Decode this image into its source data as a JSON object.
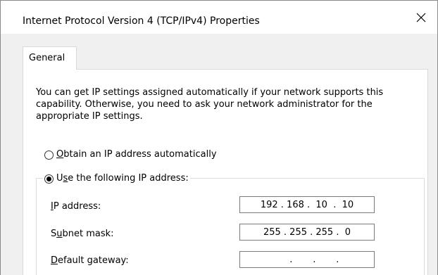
{
  "window": {
    "title": "Internet Protocol Version 4 (TCP/IPv4) Properties",
    "close_icon": "close-icon"
  },
  "tabs": [
    {
      "label": "General",
      "selected": true
    }
  ],
  "description": "You can get IP settings assigned automatically if your network supports this capability. Otherwise, you need to ask your network administrator for the appropriate IP settings.",
  "ip_mode": {
    "auto": {
      "label_pre": "",
      "label_u": "O",
      "label_post": "btain an IP address automatically",
      "checked": false
    },
    "manual": {
      "label_pre": "U",
      "label_u": "s",
      "label_post": "e the following IP address:",
      "checked": true
    }
  },
  "fields": {
    "ip_address": {
      "label_u": "I",
      "label_post": "P address:",
      "value": "192 . 168 .  10  .  10"
    },
    "subnet_mask": {
      "label_pre": "S",
      "label_u": "u",
      "label_post": "bnet mask:",
      "value": "255 . 255 . 255 .  0"
    },
    "default_gateway": {
      "label_u": "D",
      "label_post": "efault gateway:",
      "value": "     .       .       ."
    }
  },
  "colors": {
    "titlebar": "#ffffff",
    "dialog_bg": "#f0f0f0",
    "panel_bg": "#ffffff",
    "input_border": "#7a7a7a"
  }
}
